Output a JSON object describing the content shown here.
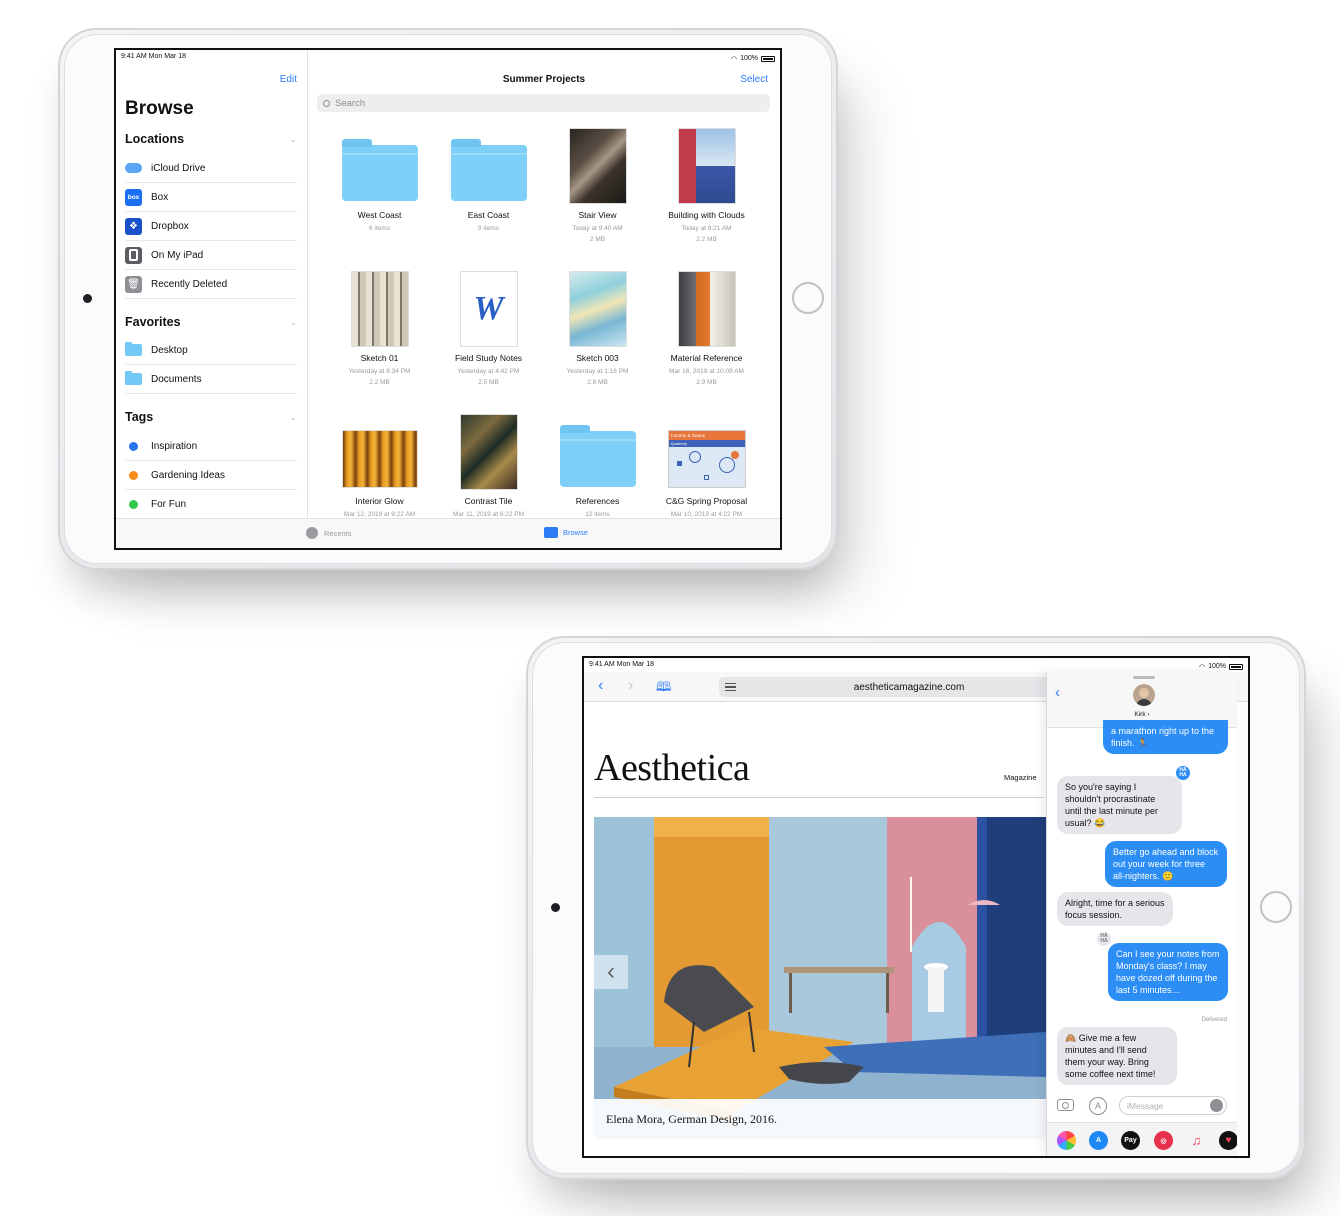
{
  "files_device": {
    "status": {
      "time": "9:41 AM  Mon Mar 18",
      "battery": "100%"
    },
    "sidebar": {
      "edit_label": "Edit",
      "title": "Browse",
      "locations_title": "Locations",
      "locations": [
        {
          "label": "iCloud Drive",
          "icon": "icloud-icon"
        },
        {
          "label": "Box",
          "icon": "box-icon",
          "badge": "box"
        },
        {
          "label": "Dropbox",
          "icon": "dropbox-icon"
        },
        {
          "label": "On My iPad",
          "icon": "ipad-icon"
        },
        {
          "label": "Recently Deleted",
          "icon": "trash-icon"
        }
      ],
      "favorites_title": "Favorites",
      "favorites": [
        {
          "label": "Desktop",
          "icon": "folder-icon"
        },
        {
          "label": "Documents",
          "icon": "folder-icon"
        }
      ],
      "tags_title": "Tags",
      "tags": [
        {
          "label": "Inspiration",
          "color": "#2a74f0"
        },
        {
          "label": "Gardening Ideas",
          "color": "#f58c1a"
        },
        {
          "label": "For Fun",
          "color": "#2fca4b"
        }
      ]
    },
    "main": {
      "title": "Summer Projects",
      "select_label": "Select",
      "search_placeholder": "Search",
      "items": [
        {
          "name": "West Coast",
          "meta1": "6 items",
          "meta2": "",
          "kind": "folder"
        },
        {
          "name": "East Coast",
          "meta1": "9 items",
          "meta2": "",
          "kind": "folder"
        },
        {
          "name": "Stair View",
          "meta1": "Today at 9:40 AM",
          "meta2": "2 MB",
          "kind": "photo-stair"
        },
        {
          "name": "Building with Clouds",
          "meta1": "Today at 9:21 AM",
          "meta2": "2.2 MB",
          "kind": "photo-building"
        },
        {
          "name": "Sketch 01",
          "meta1": "Yesterday at 8:34 PM",
          "meta2": "2.2 MB",
          "kind": "photo-sketch01"
        },
        {
          "name": "Field Study Notes",
          "meta1": "Yesterday at 4:42 PM",
          "meta2": "2.5 MB",
          "kind": "word-doc"
        },
        {
          "name": "Sketch 003",
          "meta1": "Yesterday at 1:18 PM",
          "meta2": "2.8 MB",
          "kind": "photo-sketch003"
        },
        {
          "name": "Material Reference",
          "meta1": "Mar 16, 2019 at 10:09 AM",
          "meta2": "2.9 MB",
          "kind": "photo-material"
        },
        {
          "name": "Interior Glow",
          "meta1": "Mar 12, 2019 at 9:22 AM",
          "meta2": "",
          "kind": "photo-glow"
        },
        {
          "name": "Contrast Tile",
          "meta1": "Mar 11, 2019 at 6:22 PM",
          "meta2": "",
          "kind": "photo-tile"
        },
        {
          "name": "References",
          "meta1": "12 items",
          "meta2": "",
          "kind": "folder"
        },
        {
          "name": "C&G Spring Proposal",
          "meta1": "Mar 10, 2019 at 4:22 PM",
          "meta2": "",
          "kind": "keynote"
        }
      ],
      "keynote_header": "Comme & Geaux",
      "keynote_sub": "Quarterly"
    },
    "tabbar": {
      "recents_label": "Recents",
      "browse_label": "Browse"
    }
  },
  "safari_device": {
    "status": {
      "time": "9:41 AM  Mon Mar 18",
      "battery": "100%"
    },
    "url": "aestheticamagazine.com",
    "magazine_title": "Aesthetica",
    "magazine_label": "Magazine",
    "hero_caption": "Elena Mora, German Design, 2016.",
    "messages": {
      "contact": "Kirk ›",
      "bubbles": [
        {
          "from": "me",
          "text": "a marathon right up to the finish. 🏃"
        },
        {
          "from": "them",
          "text": "So you're saying I shouldn't procrastinate until the last minute per usual? 😂"
        },
        {
          "from": "me",
          "text": "Better go ahead and block out your week for three all-nighters. 🙂"
        },
        {
          "from": "them",
          "text": "Alright, time for a serious focus session."
        },
        {
          "from": "me",
          "text": "Can I see your notes from Monday's class? I may have dozed off during the last 5 minutes…"
        },
        {
          "from": "them",
          "text": "🙈 Give me a few minutes and I'll send them your way. Bring some coffee next time!"
        }
      ],
      "tapback": "HA HA",
      "delivered": "Delivered",
      "input_placeholder": "iMessage",
      "applepay_label": "Pay"
    }
  }
}
